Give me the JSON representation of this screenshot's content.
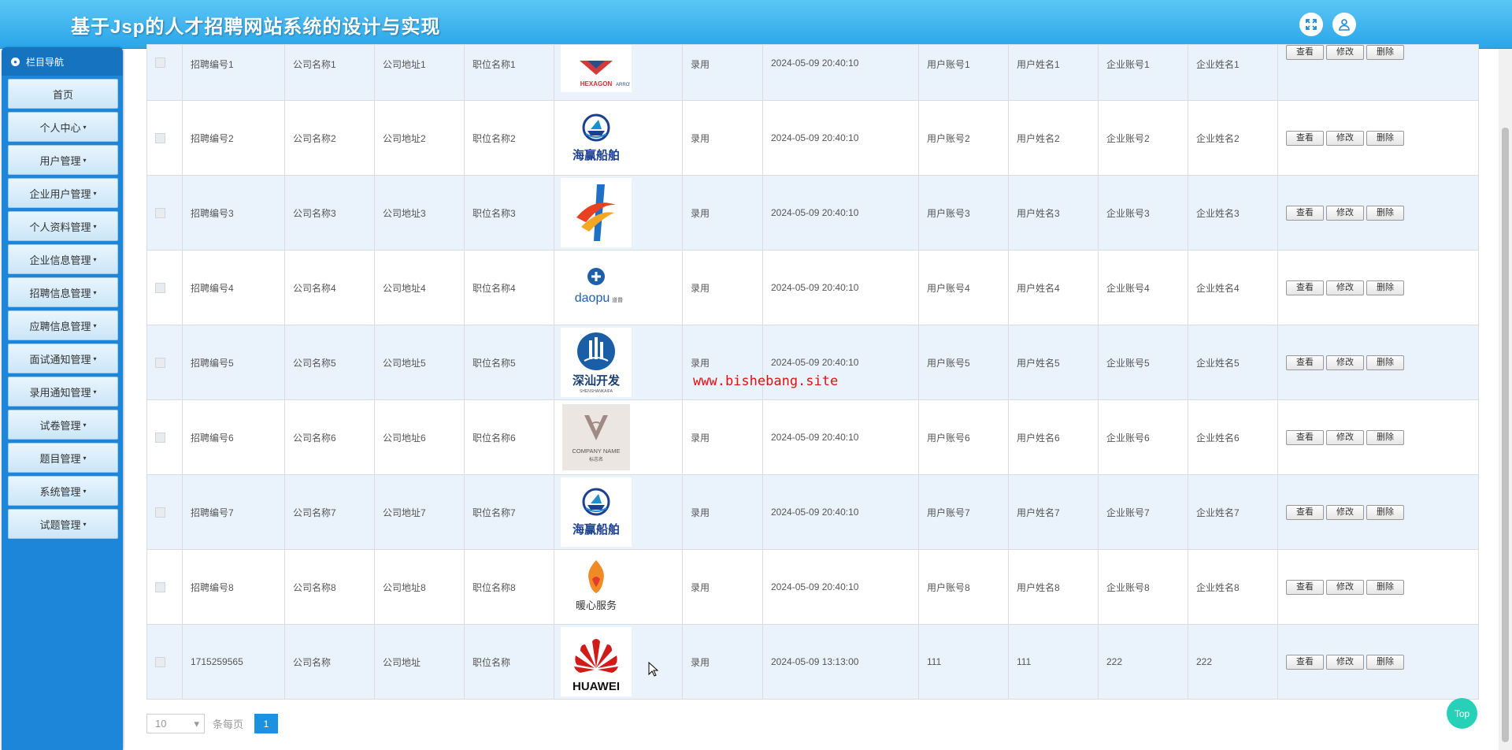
{
  "app": {
    "title": "基于Jsp的人才招聘网站系统的设计与实现"
  },
  "header": {
    "icons": [
      "fullscreen-icon",
      "user-icon"
    ]
  },
  "sidebar": {
    "heading": "栏目导航",
    "items": [
      {
        "label": "首页"
      },
      {
        "label": "个人中心"
      },
      {
        "label": "用户管理"
      },
      {
        "label": "企业用户管理"
      },
      {
        "label": "个人资料管理"
      },
      {
        "label": "企业信息管理"
      },
      {
        "label": "招聘信息管理"
      },
      {
        "label": "应聘信息管理"
      },
      {
        "label": "面试通知管理"
      },
      {
        "label": "录用通知管理"
      },
      {
        "label": "试卷管理"
      },
      {
        "label": "题目管理"
      },
      {
        "label": "系统管理"
      },
      {
        "label": "试题管理"
      }
    ]
  },
  "table": {
    "actions": {
      "view": "查看",
      "edit": "修改",
      "delete": "删除"
    },
    "rows": [
      {
        "code": "招聘编号1",
        "company": "公司名称1",
        "address": "公司地址1",
        "position": "职位名称1",
        "logo": "hexagon-arrow-logo",
        "logo_text": "HEXAGON",
        "logo_sub": "ARROW",
        "status": "录用",
        "time": "2024-05-09 20:40:10",
        "user_account": "用户账号1",
        "user_name": "用户姓名1",
        "ent_account": "企业账号1",
        "ent_name": "企业姓名1"
      },
      {
        "code": "招聘编号2",
        "company": "公司名称2",
        "address": "公司地址2",
        "position": "职位名称2",
        "logo": "ship-logo",
        "logo_text": "海赢船舶",
        "status": "录用",
        "time": "2024-05-09 20:40:10",
        "user_account": "用户账号2",
        "user_name": "用户姓名2",
        "ent_account": "企业账号2",
        "ent_name": "企业姓名2"
      },
      {
        "code": "招聘编号3",
        "company": "公司名称3",
        "address": "公司地址3",
        "position": "职位名称3",
        "logo": "swirl-logo",
        "status": "录用",
        "time": "2024-05-09 20:40:10",
        "user_account": "用户账号3",
        "user_name": "用户姓名3",
        "ent_account": "企业账号3",
        "ent_name": "企业姓名3"
      },
      {
        "code": "招聘编号4",
        "company": "公司名称4",
        "address": "公司地址4",
        "position": "职位名称4",
        "logo": "daopu-logo",
        "logo_text": "daopu",
        "logo_sub": "道普",
        "status": "录用",
        "time": "2024-05-09 20:40:10",
        "user_account": "用户账号4",
        "user_name": "用户姓名4",
        "ent_account": "企业账号4",
        "ent_name": "企业姓名4"
      },
      {
        "code": "招聘编号5",
        "company": "公司名称5",
        "address": "公司地址5",
        "position": "职位名称5",
        "logo": "shenshan-logo",
        "logo_text": "深汕开发",
        "logo_sub": "SHENSHANKAIFA",
        "status": "录用",
        "time": "2024-05-09 20:40:10",
        "user_account": "用户账号5",
        "user_name": "用户姓名5",
        "ent_account": "企业账号5",
        "ent_name": "企业姓名5"
      },
      {
        "code": "招聘编号6",
        "company": "公司名称6",
        "address": "公司地址6",
        "position": "职位名称6",
        "logo": "company-name-logo",
        "logo_text": "COMPANY NAME",
        "logo_sub": "标志名",
        "status": "录用",
        "time": "2024-05-09 20:40:10",
        "user_account": "用户账号6",
        "user_name": "用户姓名6",
        "ent_account": "企业账号6",
        "ent_name": "企业姓名6"
      },
      {
        "code": "招聘编号7",
        "company": "公司名称7",
        "address": "公司地址7",
        "position": "职位名称7",
        "logo": "ship-logo",
        "logo_text": "海赢船舶",
        "status": "录用",
        "time": "2024-05-09 20:40:10",
        "user_account": "用户账号7",
        "user_name": "用户姓名7",
        "ent_account": "企业账号7",
        "ent_name": "企业姓名7"
      },
      {
        "code": "招聘编号8",
        "company": "公司名称8",
        "address": "公司地址8",
        "position": "职位名称8",
        "logo": "warm-service-logo",
        "logo_text": "暖心服务",
        "status": "录用",
        "time": "2024-05-09 20:40:10",
        "user_account": "用户账号8",
        "user_name": "用户姓名8",
        "ent_account": "企业账号8",
        "ent_name": "企业姓名8"
      },
      {
        "code": "1715259565",
        "company": "公司名称",
        "address": "公司地址",
        "position": "职位名称",
        "logo": "huawei-logo",
        "logo_text": "HUAWEI",
        "status": "录用",
        "time": "2024-05-09 13:13:00",
        "user_account": "111",
        "user_name": "111",
        "ent_account": "222",
        "ent_name": "222"
      }
    ]
  },
  "watermark": "www.bishebang.site",
  "pagination": {
    "page_size": "10",
    "per_page_label": "条每页",
    "current_page": "1"
  },
  "top_button": "Top",
  "colors": {
    "header": "#29a6ea",
    "sidebar": "#1e86d9",
    "row_alt": "#eaf3fb",
    "top_button": "#27d1b8",
    "watermark": "#e01010"
  }
}
